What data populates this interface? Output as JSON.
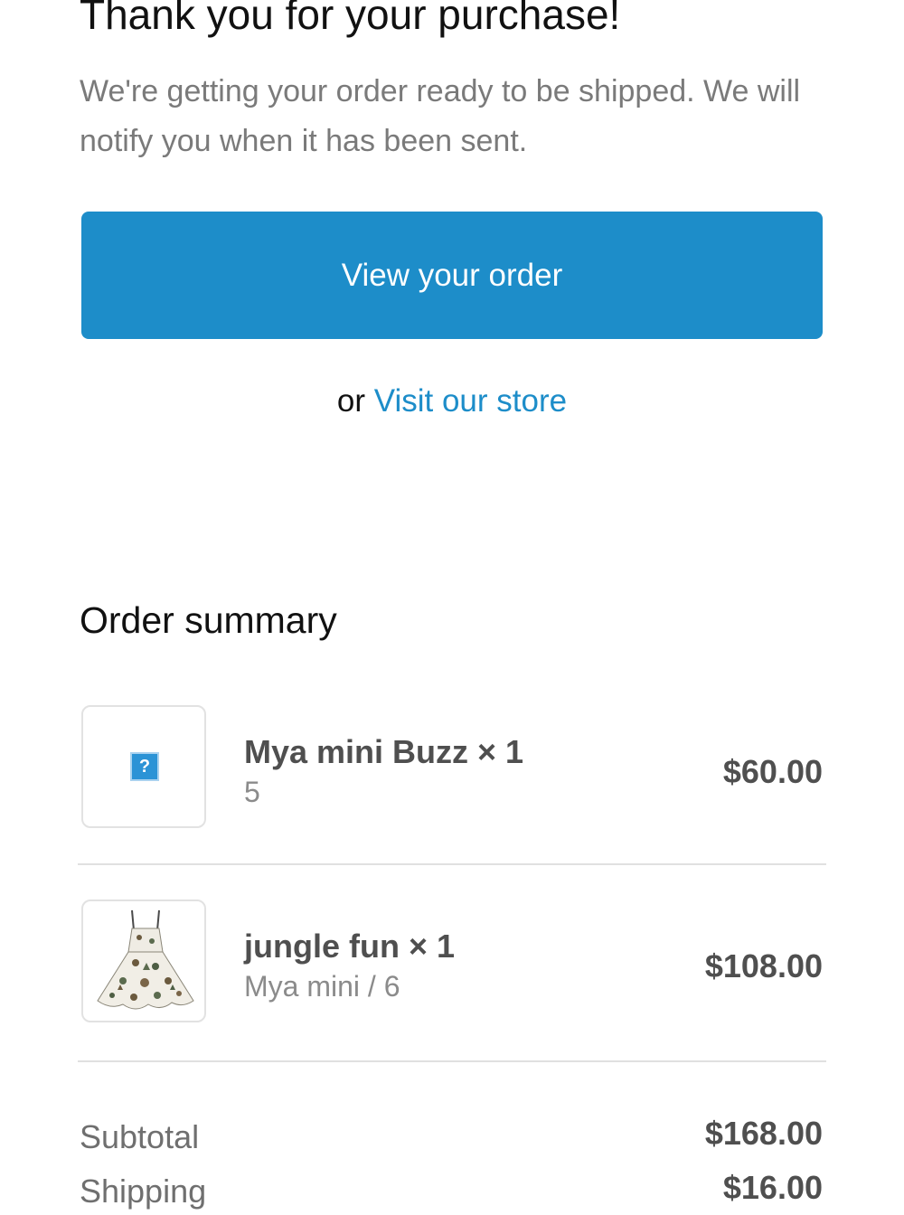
{
  "header": {
    "title": "Thank you for your purchase!",
    "message": "We're getting your order ready to be shipped. We will notify you when it has been sent."
  },
  "actions": {
    "view_order_label": "View your order",
    "or_text": "or",
    "visit_store_label": "Visit our store"
  },
  "summary": {
    "title": "Order summary",
    "items": [
      {
        "name": "Mya mini Buzz × 1",
        "variant": "5",
        "price": "$60.00",
        "image": "missing-image-placeholder"
      },
      {
        "name": "jungle fun × 1",
        "variant": "Mya mini / 6",
        "price": "$108.00",
        "image": "dress-thumbnail"
      }
    ],
    "totals": {
      "subtotal_label": "Subtotal",
      "subtotal_value": "$168.00",
      "shipping_label": "Shipping",
      "shipping_value": "$16.00"
    }
  },
  "colors": {
    "accent": "#1d8dc9",
    "muted_text": "#7a7a7a",
    "divider": "#e0e0e0"
  }
}
